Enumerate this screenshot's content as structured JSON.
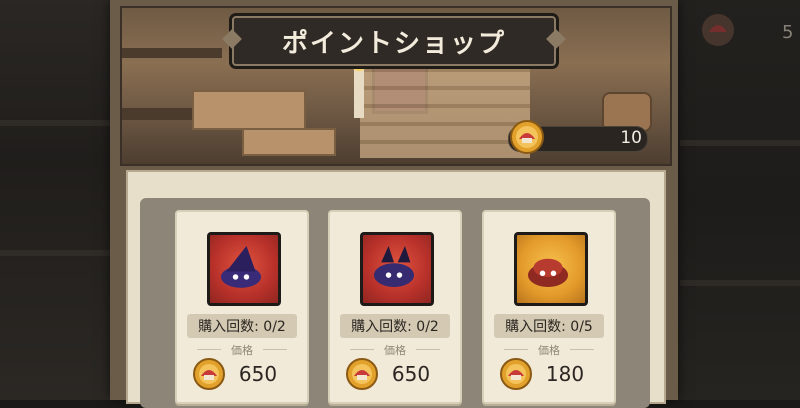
{
  "shop": {
    "title": "ポイントショップ",
    "points": "10"
  },
  "top_right": {
    "count": "5"
  },
  "items": [
    {
      "buy_count": "購入回数: 0/2",
      "price_label": "価格",
      "price": "650",
      "icon": "witch-hat-slime-icon",
      "icon_bg": "#c23a2e"
    },
    {
      "buy_count": "購入回数: 0/2",
      "price_label": "価格",
      "price": "650",
      "icon": "dragon-slime-icon",
      "icon_bg": "#c23a2e"
    },
    {
      "buy_count": "購入回数: 0/5",
      "price_label": "価格",
      "price": "180",
      "icon": "red-slime-icon",
      "icon_bg": "#e8a634"
    }
  ],
  "colors": {
    "panel_bg": "#e8dfca",
    "card_bg": "#f1ead8",
    "title_plate": "#2f2a25"
  }
}
